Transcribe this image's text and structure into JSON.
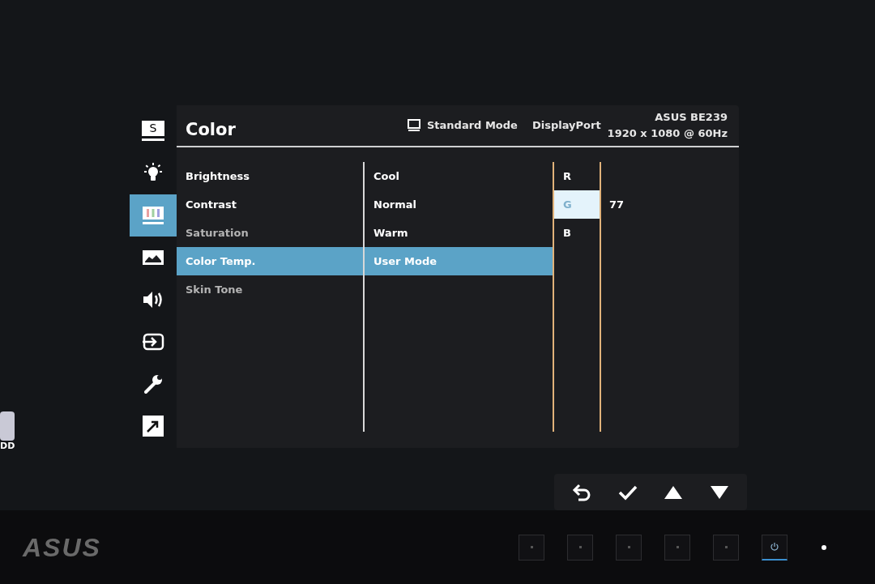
{
  "sidebar": {
    "items": [
      {
        "kind": "splendid",
        "label": "S",
        "selected": false
      },
      {
        "kind": "brightness",
        "selected": false
      },
      {
        "kind": "color",
        "selected": true
      },
      {
        "kind": "image",
        "selected": false
      },
      {
        "kind": "sound",
        "selected": false
      },
      {
        "kind": "input",
        "selected": false
      },
      {
        "kind": "system",
        "selected": false
      },
      {
        "kind": "shortcut",
        "selected": false
      }
    ]
  },
  "header": {
    "title": "Color",
    "mode": "Standard Mode",
    "input": "DisplayPort",
    "resolution": "1920 x 1080 @ 60Hz",
    "model": "ASUS BE239"
  },
  "menu": {
    "items": [
      {
        "label": "Brightness",
        "selected": false,
        "disabled": false
      },
      {
        "label": "Contrast",
        "selected": false,
        "disabled": false
      },
      {
        "label": "Saturation",
        "selected": false,
        "disabled": true
      },
      {
        "label": "Color Temp.",
        "selected": true,
        "disabled": false
      },
      {
        "label": "Skin Tone",
        "selected": false,
        "disabled": true
      }
    ]
  },
  "submenu": {
    "items": [
      {
        "label": "Cool",
        "selected": false
      },
      {
        "label": "Normal",
        "selected": false
      },
      {
        "label": "Warm",
        "selected": false
      },
      {
        "label": "User Mode",
        "selected": true
      }
    ]
  },
  "channels": {
    "items": [
      {
        "label": "R",
        "selected": false
      },
      {
        "label": "G",
        "selected": true,
        "value": "77"
      },
      {
        "label": "B",
        "selected": false
      }
    ]
  },
  "nav_buttons": [
    {
      "kind": "back"
    },
    {
      "kind": "ok"
    },
    {
      "kind": "up"
    },
    {
      "kind": "down"
    }
  ],
  "desktop_icon": {
    "label": "DD"
  },
  "bezel": {
    "logo": "ASUS",
    "buttons": [
      {
        "kind": "plain"
      },
      {
        "kind": "plain"
      },
      {
        "kind": "plain"
      },
      {
        "kind": "plain"
      },
      {
        "kind": "plain"
      },
      {
        "kind": "power"
      }
    ],
    "led_on": true
  }
}
